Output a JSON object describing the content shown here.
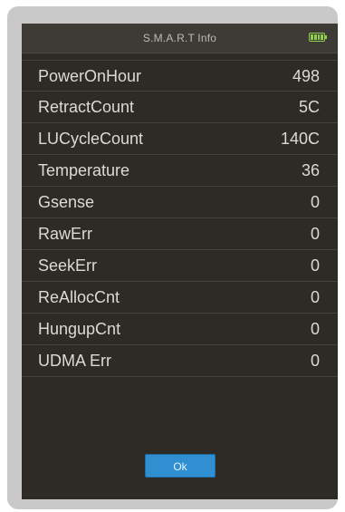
{
  "title": "S.M.A.R.T Info",
  "battery_icon": "battery-full-icon",
  "accent_color": "#2f8fd1",
  "battery_color": "#8ed24a",
  "rows": [
    {
      "label": "PowerOnHour",
      "value": "498"
    },
    {
      "label": "RetractCount",
      "value": "5C"
    },
    {
      "label": "LUCycleCount",
      "value": "140C"
    },
    {
      "label": "Temperature",
      "value": "36"
    },
    {
      "label": "Gsense",
      "value": "0"
    },
    {
      "label": "RawErr",
      "value": "0"
    },
    {
      "label": "SeekErr",
      "value": "0"
    },
    {
      "label": "ReAllocCnt",
      "value": "0"
    },
    {
      "label": "HungupCnt",
      "value": "0"
    },
    {
      "label": "UDMA Err",
      "value": "0"
    }
  ],
  "ok_label": "Ok"
}
